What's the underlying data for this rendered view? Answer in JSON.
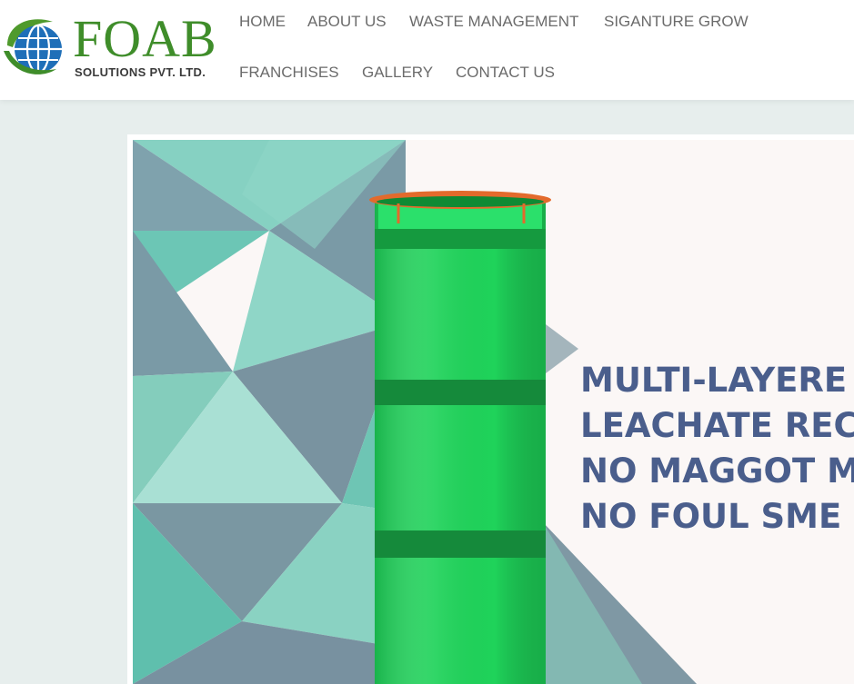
{
  "brand": {
    "name": "FOAB",
    "tagline": "SOLUTIONS PVT. LTD.",
    "colors": {
      "primary_green": "#3f8d2a",
      "globe_blue": "#1f6fb8"
    }
  },
  "nav": {
    "items": [
      {
        "label": "HOME"
      },
      {
        "label": "ABOUT US"
      },
      {
        "label": "WASTE MANAGEMENT"
      },
      {
        "label": "SIGANTURE GROW"
      },
      {
        "label": "FRANCHISES"
      },
      {
        "label": "GALLERY"
      },
      {
        "label": "CONTACT US"
      }
    ]
  },
  "hero": {
    "lines": [
      "MULTI-LAYERE",
      "LEACHATE REC",
      "NO MAGGOT M",
      "NO FOUL SME"
    ],
    "text_color": "#4a5e8c",
    "product": "green multi-layer compost bin"
  }
}
